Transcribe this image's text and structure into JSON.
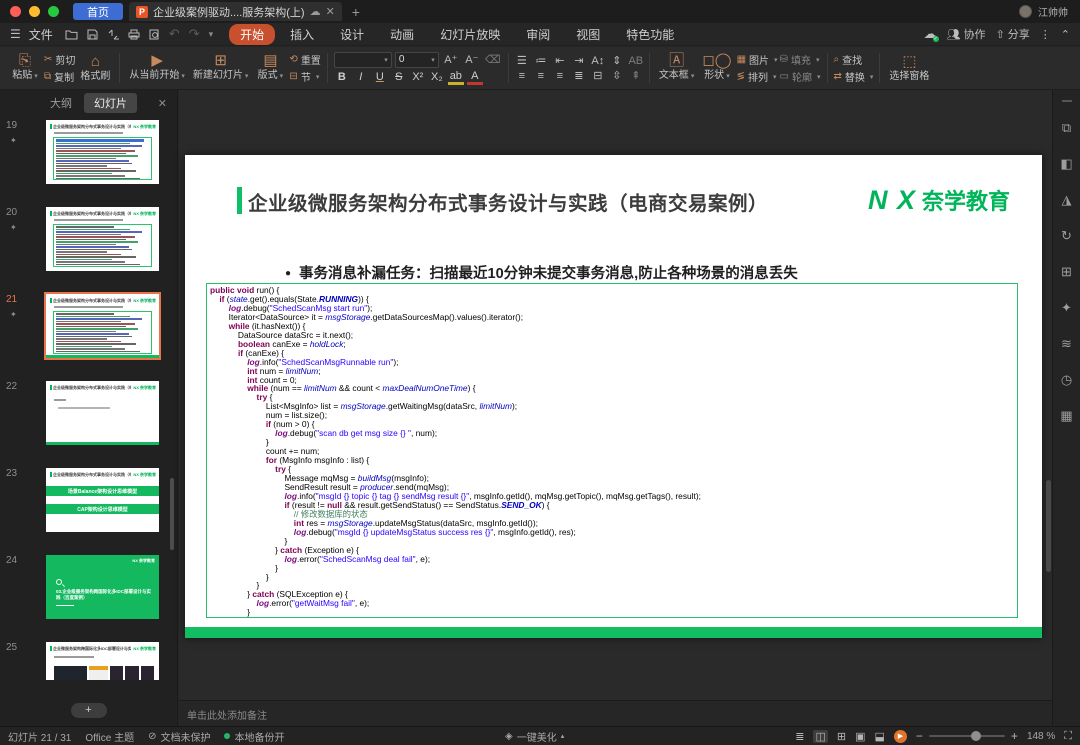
{
  "colors": {
    "green": "#00b45a",
    "orange": "#c9502e",
    "blue": "#3d6dd2",
    "select_orange": "#e8754a"
  },
  "titlebar": {
    "home": "首页",
    "doc_tab": "企业级案例驱动....服务架构(上)",
    "user": "江帅帅",
    "new_tab": "+"
  },
  "menubar": {
    "file": "文件",
    "tabs": [
      "开始",
      "插入",
      "设计",
      "动画",
      "幻灯片放映",
      "审阅",
      "视图",
      "特色功能"
    ],
    "active": "开始",
    "collab": "协作",
    "share": "分享"
  },
  "toolbar": {
    "paste": "粘贴",
    "cut": "剪切",
    "copy": "复制",
    "format_painter": "格式刷",
    "play_from_current": "从当前开始",
    "new_slide": "新建幻灯片",
    "layout": "版式",
    "reset": "重置",
    "section": "节",
    "font_name": "",
    "font_size": "0",
    "bold": "B",
    "italic": "I",
    "underline": "U",
    "strike": "S",
    "sup": "X²",
    "sub": "X₂",
    "textbox": "文本框",
    "shapes": "形状",
    "picture": "图片",
    "arrange": "排列",
    "fill": "填充",
    "outline": "轮廓",
    "find": "查找",
    "replace": "替换",
    "selection_pane": "选择窗格"
  },
  "sidebar": {
    "outline_tab": "大纲",
    "slides_tab": "幻灯片",
    "add_label": "+",
    "thumbs": [
      {
        "num": "19",
        "kind": "code",
        "star": true,
        "selected": false,
        "title": "企业级微服务架构分布式事务设计与实践（电商交易案例）",
        "logo": "NX 奈学教育",
        "highlight": true
      },
      {
        "num": "20",
        "kind": "code",
        "star": true,
        "selected": false,
        "title": "企业级微服务架构分布式事务设计与实践（电商交易案例）",
        "logo": "NX 奈学教育",
        "highlight": false
      },
      {
        "num": "21",
        "kind": "code",
        "star": true,
        "selected": true,
        "title": "企业级微服务架构分布式事务设计与实践（电商交易案例）",
        "logo": "NX 奈学教育",
        "highlight": false
      },
      {
        "num": "22",
        "kind": "text",
        "star": false,
        "selected": false,
        "title": "企业级微服务架构分布式事务设计与实践（电商交易案例）",
        "logo": "NX 奈学教育"
      },
      {
        "num": "23",
        "kind": "bars",
        "star": false,
        "selected": false,
        "title": "企业级微服务架构分布式事务设计与实践（电商交易案例）",
        "logo": "NX 奈学教育",
        "bars": [
          "场景Balance架构设计思维模型",
          "CAP架构设计思维模型"
        ]
      },
      {
        "num": "24",
        "kind": "green",
        "star": false,
        "selected": false,
        "logo": "NX 奈学教育",
        "text": "03.企业级服务架构跨国际化多IDC部署设计与实践（百度案例）"
      },
      {
        "num": "25",
        "kind": "images",
        "star": false,
        "selected": false,
        "title": "企业微服务架构跨国际化多IDC部署设计与实践（百度案例）",
        "logo": "NX 奈学教育"
      }
    ]
  },
  "slide": {
    "title": "企业级微服务架构分布式事务设计与实践（电商交易案例）",
    "logo_nx": "N X",
    "logo_name": "奈学教育",
    "bullet": "事务消息补漏任务：扫描最近10分钟未提交事务消息,防止各种场景的消息丢失",
    "code_lines": [
      [
        [
          "k",
          "public"
        ],
        [
          "p",
          " "
        ],
        [
          "k",
          "void"
        ],
        [
          "p",
          " run() {"
        ]
      ],
      [
        [
          "p",
          "    "
        ],
        [
          "k",
          "if"
        ],
        [
          "p",
          " ("
        ],
        [
          "f",
          "state"
        ],
        [
          "p",
          ".get().equals(State."
        ],
        [
          "x",
          "RUNNING"
        ],
        [
          "p",
          ")) {"
        ]
      ],
      [
        [
          "p",
          "        "
        ],
        [
          "l",
          "log"
        ],
        [
          "p",
          ".debug("
        ],
        [
          "s",
          "\"SchedScanMsg start run\""
        ],
        [
          "p",
          ");"
        ]
      ],
      [
        [
          "p",
          "        Iterator<DataSource> it = "
        ],
        [
          "f",
          "msgStorage"
        ],
        [
          "p",
          ".getDataSourcesMap().values().iterator();"
        ]
      ],
      [
        [
          "p",
          "        "
        ],
        [
          "k",
          "while"
        ],
        [
          "p",
          " (it.hasNext()) {"
        ]
      ],
      [
        [
          "p",
          "            DataSource dataSrc = it.next();"
        ]
      ],
      [
        [
          "p",
          "            "
        ],
        [
          "k",
          "boolean"
        ],
        [
          "p",
          " canExe = "
        ],
        [
          "f",
          "holdLock"
        ],
        [
          "p",
          ";"
        ]
      ],
      [
        [
          "p",
          "            "
        ],
        [
          "k",
          "if"
        ],
        [
          "p",
          " (canExe) {"
        ]
      ],
      [
        [
          "p",
          "                "
        ],
        [
          "l",
          "log"
        ],
        [
          "p",
          ".info("
        ],
        [
          "s",
          "\"SchedScanMsgRunnable run\""
        ],
        [
          "p",
          ");"
        ]
      ],
      [
        [
          "p",
          "                "
        ],
        [
          "k",
          "int"
        ],
        [
          "p",
          " num = "
        ],
        [
          "f",
          "limitNum"
        ],
        [
          "p",
          ";"
        ]
      ],
      [
        [
          "p",
          "                "
        ],
        [
          "k",
          "int"
        ],
        [
          "p",
          " count = 0;"
        ]
      ],
      [
        [
          "p",
          "                "
        ],
        [
          "k",
          "while"
        ],
        [
          "p",
          " (num == "
        ],
        [
          "f",
          "limitNum"
        ],
        [
          "p",
          " && count < "
        ],
        [
          "f",
          "maxDealNumOneTime"
        ],
        [
          "p",
          ") {"
        ]
      ],
      [
        [
          "p",
          "                    "
        ],
        [
          "k",
          "try"
        ],
        [
          "p",
          " {"
        ]
      ],
      [
        [
          "p",
          "                        List<MsgInfo> list = "
        ],
        [
          "f",
          "msgStorage"
        ],
        [
          "p",
          ".getWaitingMsg(dataSrc, "
        ],
        [
          "f",
          "limitNum"
        ],
        [
          "p",
          ");"
        ]
      ],
      [
        [
          "p",
          "                        num = list.size();"
        ]
      ],
      [
        [
          "p",
          "                        "
        ],
        [
          "k",
          "if"
        ],
        [
          "p",
          " (num > 0) {"
        ]
      ],
      [
        [
          "p",
          "                            "
        ],
        [
          "l",
          "log"
        ],
        [
          "p",
          ".debug("
        ],
        [
          "s",
          "\"scan db get msg size {} \""
        ],
        [
          "p",
          ", num);"
        ]
      ],
      [
        [
          "p",
          "                        }"
        ]
      ],
      [
        [
          "p",
          "                        count += num;"
        ]
      ],
      [
        [
          "p",
          "                        "
        ],
        [
          "k",
          "for"
        ],
        [
          "p",
          " (MsgInfo msgInfo : list) {"
        ]
      ],
      [
        [
          "p",
          "                            "
        ],
        [
          "k",
          "try"
        ],
        [
          "p",
          " {"
        ]
      ],
      [
        [
          "p",
          "                                Message mqMsg = "
        ],
        [
          "f",
          "buildMsg"
        ],
        [
          "p",
          "(msgInfo);"
        ]
      ],
      [
        [
          "p",
          "                                SendResult result = "
        ],
        [
          "f",
          "producer"
        ],
        [
          "p",
          ".send(mqMsg);"
        ]
      ],
      [
        [
          "p",
          "                                "
        ],
        [
          "l",
          "log"
        ],
        [
          "p",
          ".info("
        ],
        [
          "s",
          "\"msgId {} topic {} tag {} sendMsg result {}\""
        ],
        [
          "p",
          ", msgInfo.getId(), mqMsg.getTopic(), mqMsg.getTags(), result);"
        ]
      ],
      [
        [
          "p",
          "                                "
        ],
        [
          "k",
          "if"
        ],
        [
          "p",
          " (result != "
        ],
        [
          "k",
          "null"
        ],
        [
          "p",
          " && result.getSendStatus() == SendStatus."
        ],
        [
          "x",
          "SEND_OK"
        ],
        [
          "p",
          ") {"
        ]
      ],
      [
        [
          "p",
          "                                    "
        ],
        [
          "c",
          "// 修改数据库的状态"
        ]
      ],
      [
        [
          "p",
          "                                    "
        ],
        [
          "k",
          "int"
        ],
        [
          "p",
          " res = "
        ],
        [
          "f",
          "msgStorage"
        ],
        [
          "p",
          ".updateMsgStatus(dataSrc, msgInfo.getId());"
        ]
      ],
      [
        [
          "p",
          "                                    "
        ],
        [
          "l",
          "log"
        ],
        [
          "p",
          ".debug("
        ],
        [
          "s",
          "\"msgId {} updateMsgStatus success res {}\""
        ],
        [
          "p",
          ", msgInfo.getId(), res);"
        ]
      ],
      [
        [
          "p",
          "                                }"
        ]
      ],
      [
        [
          "p",
          "                            } "
        ],
        [
          "k",
          "catch"
        ],
        [
          "p",
          " (Exception e) {"
        ]
      ],
      [
        [
          "p",
          "                                "
        ],
        [
          "l",
          "log"
        ],
        [
          "p",
          ".error("
        ],
        [
          "s",
          "\"SchedScanMsg deal fail\""
        ],
        [
          "p",
          ", e);"
        ]
      ],
      [
        [
          "p",
          "                            }"
        ]
      ],
      [
        [
          "p",
          "                        }"
        ]
      ],
      [
        [
          "p",
          "                    }"
        ]
      ],
      [
        [
          "p",
          "                } "
        ],
        [
          "k",
          "catch"
        ],
        [
          "p",
          " (SQLException e) {"
        ]
      ],
      [
        [
          "p",
          "                    "
        ],
        [
          "l",
          "log"
        ],
        [
          "p",
          ".error("
        ],
        [
          "s",
          "\"getWaitMsg fail\""
        ],
        [
          "p",
          ", e);"
        ]
      ],
      [
        [
          "p",
          "                }"
        ]
      ]
    ]
  },
  "right_rail": {
    "icons": [
      {
        "name": "panel-properties-icon",
        "glyph": "⧉"
      },
      {
        "name": "panel-shapes-icon",
        "glyph": "◧"
      },
      {
        "name": "panel-design-icon",
        "glyph": "◮"
      },
      {
        "name": "panel-animation-icon",
        "glyph": "↻"
      },
      {
        "name": "panel-layers-icon",
        "glyph": "⊞"
      },
      {
        "name": "panel-effects-icon",
        "glyph": "✦"
      },
      {
        "name": "panel-settings-icon",
        "glyph": "≋"
      },
      {
        "name": "panel-history-icon",
        "glyph": "◷"
      },
      {
        "name": "panel-image-icon",
        "glyph": "▦"
      }
    ]
  },
  "notes": {
    "placeholder": "单击此处添加备注"
  },
  "statusbar": {
    "slide_info": "幻灯片 21 / 31",
    "theme": "Office 主题",
    "protect": "文档未保护",
    "backup": "本地备份开",
    "beautify": "一键美化",
    "zoom_value": "148 %",
    "view_icons": [
      {
        "name": "notes-panel-icon",
        "glyph": "≣",
        "on": false
      },
      {
        "name": "normal-view-icon",
        "glyph": "◫",
        "on": true
      },
      {
        "name": "slide-sorter-icon",
        "glyph": "⊞",
        "on": false
      },
      {
        "name": "reading-view-icon",
        "glyph": "▣",
        "on": false
      },
      {
        "name": "presenter-view-icon",
        "glyph": "⬓",
        "on": false
      }
    ]
  }
}
